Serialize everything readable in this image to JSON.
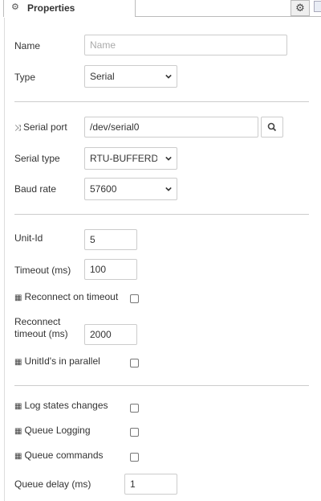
{
  "tab": {
    "title": "Properties",
    "icon": "gear-icon"
  },
  "fields": {
    "name": {
      "label": "Name",
      "value": "",
      "placeholder": "Name"
    },
    "type": {
      "label": "Type",
      "value": "Serial"
    },
    "serial_port": {
      "label": "Serial port",
      "icon": "random-icon",
      "value": "/dev/serial0"
    },
    "serial_type": {
      "label": "Serial type",
      "value": "RTU-BUFFERD"
    },
    "baud_rate": {
      "label": "Baud rate",
      "value": "57600"
    },
    "unit_id": {
      "label": "Unit-Id",
      "value": "5"
    },
    "timeout": {
      "label": "Timeout (ms)",
      "value": "100"
    },
    "reconnect_on_timeout": {
      "label": "Reconnect on timeout",
      "icon": "table-icon",
      "checked": false
    },
    "reconnect_timeout": {
      "label_line1": "Reconnect",
      "label_line2": "timeout (ms)",
      "value": "2000"
    },
    "unitids_parallel": {
      "label": "UnitId's in parallel",
      "icon": "table-icon",
      "checked": false
    },
    "log_states": {
      "label": "Log states changes",
      "icon": "table-icon",
      "checked": false
    },
    "queue_logging": {
      "label": "Queue Logging",
      "icon": "table-icon",
      "checked": false
    },
    "queue_commands": {
      "label": "Queue commands",
      "icon": "table-icon",
      "checked": false
    },
    "queue_delay": {
      "label": "Queue delay (ms)",
      "value": "1"
    }
  }
}
